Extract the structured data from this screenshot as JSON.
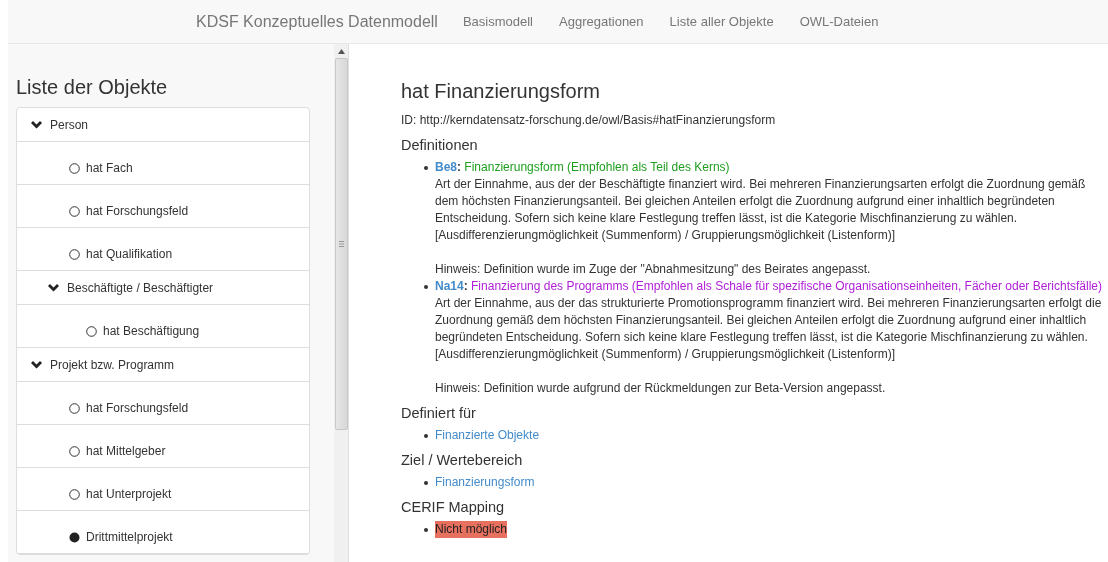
{
  "navbar": {
    "brand": "KDSF Konzeptuelles Datenmodell",
    "links": [
      {
        "label": "Basismodell",
        "selected": false
      },
      {
        "label": "Aggregationen",
        "selected": false
      },
      {
        "label": "Liste aller Objekte",
        "selected": false
      },
      {
        "label": "OWL-Dateien",
        "selected": false
      }
    ]
  },
  "sidebar": {
    "title": "Liste der Objekte",
    "items": [
      {
        "label": "Person",
        "kind": "group",
        "expanded": true,
        "children": [
          {
            "label": "hat Fach",
            "kind": "property"
          },
          {
            "label": "hat Forschungsfeld",
            "kind": "property"
          },
          {
            "label": "hat Qualifikation",
            "kind": "property"
          },
          {
            "label": "Beschäftigte / Beschäftigter",
            "kind": "group",
            "expanded": true,
            "children": [
              {
                "label": "hat Beschäftigung",
                "kind": "property"
              }
            ]
          }
        ]
      },
      {
        "label": "Projekt bzw. Programm",
        "kind": "group",
        "expanded": true,
        "children": [
          {
            "label": "hat Forschungsfeld",
            "kind": "property"
          },
          {
            "label": "hat Mittelgeber",
            "kind": "property"
          },
          {
            "label": "hat Unterprojekt",
            "kind": "property"
          },
          {
            "label": "Drittmittelprojekt",
            "kind": "class"
          }
        ]
      }
    ]
  },
  "content": {
    "title": "hat Finanzierungsform",
    "id": "ID: http://kerndatensatz-forschung.de/owl/Basis#hatFinanzierungsform",
    "sections": [
      {
        "heading": "Definitionen",
        "kind": "definitions",
        "definitions": [
          {
            "code": "Be8",
            "separator": ":",
            "title": "Finanzierungsform (Empfohlen als Teil des Kerns)",
            "color": "#1e9e1e",
            "description": "Art der Einnahme, aus der der Beschäftigte finanziert wird. Bei mehreren Finanzierungsarten erfolgt die Zuordnung gemäß dem höchsten Finanzierungsanteil. Bei gleichen Anteilen erfolgt die Zuordnung aufgrund einer inhaltlich begründeten Entscheidung. Sofern sich keine klare Festlegung treffen lässt, ist die Kategorie Mischfinanzierung zu wählen.",
            "note": "[Ausdifferenzierungmöglichkeit (Summenform) / Gruppierungsmöglichkeit (Listenform)]",
            "hint": "Hinweis: Definition wurde im Zuge der \"Abnahmesitzung\" des Beirates angepasst."
          },
          {
            "code": "Na14",
            "separator": ":",
            "title": "Finanzierung des Programms (Empfohlen als Schale für spezifische Organisationseinheiten, Fächer oder Berichtsfälle)",
            "color": "#b01ed8",
            "description": "Art der Einnahme, aus der das strukturierte Promotionsprogramm finanziert wird. Bei mehreren Finanzierungsarten erfolgt die Zuordnung gemäß dem höchsten Finanzierungsanteil. Bei gleichen Anteilen erfolgt die Zuordnung aufgrund einer inhaltlich begründeten Entscheidung. Sofern sich keine klare Festlegung treffen lässt, ist die Kategorie Mischfinanzierung zu wählen.",
            "note": "[Ausdifferenzierungmöglichkeit (Summenform) / Gruppierungsmöglichkeit (Listenform)]",
            "hint": "Hinweis: Definition wurde aufgrund der Rückmeldungen zur Beta-Version angepasst."
          }
        ]
      },
      {
        "heading": "Definiert für",
        "kind": "links",
        "items": [
          "Finanzierte Objekte"
        ]
      },
      {
        "heading": "Ziel / Wertebereich",
        "kind": "links",
        "items": [
          "Finanzierungsform"
        ]
      },
      {
        "heading": "CERIF Mapping",
        "kind": "status",
        "items": [
          "Nicht möglich"
        ]
      }
    ]
  }
}
